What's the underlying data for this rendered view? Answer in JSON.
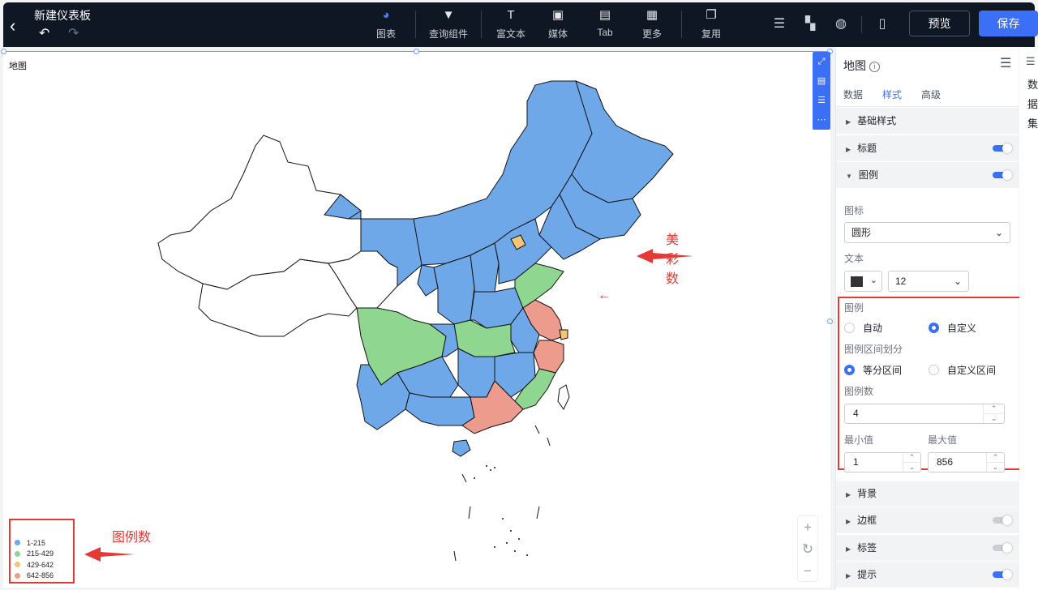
{
  "header": {
    "back_icon": "chevron-left-icon",
    "title": "新建仪表板",
    "tools": [
      {
        "label": "图表",
        "icon": "pie-chart-icon",
        "glyph": "◕",
        "active": true
      },
      {
        "label": "查询组件",
        "icon": "filter-icon",
        "glyph": "▼",
        "active": false
      },
      {
        "label": "富文本",
        "icon": "text-icon",
        "glyph": "T",
        "active": false
      },
      {
        "label": "媒体",
        "icon": "image-icon",
        "glyph": "▣",
        "active": false
      },
      {
        "label": "Tab",
        "icon": "tab-icon",
        "glyph": "▤",
        "active": false
      },
      {
        "label": "更多",
        "icon": "grid-icon",
        "glyph": "▦",
        "active": false
      },
      {
        "label": "复用",
        "icon": "copy-icon",
        "glyph": "❐",
        "active": false
      }
    ],
    "preview_label": "预览",
    "save_label": "保存",
    "accent": "#3b6ff5"
  },
  "canvas": {
    "title": "地图",
    "annotation_color": "美彩数",
    "annotation_legend": "图例数"
  },
  "legend": {
    "items": [
      {
        "label": "1-215",
        "color": "#6fa8e8"
      },
      {
        "label": "215-429",
        "color": "#8fd691"
      },
      {
        "label": "429-642",
        "color": "#f2c57a"
      },
      {
        "label": "642-856",
        "color": "#ec9b8c"
      }
    ]
  },
  "panel": {
    "title": "地图",
    "tabs": [
      {
        "label": "数据",
        "active": false
      },
      {
        "label": "样式",
        "active": true
      },
      {
        "label": "高级",
        "active": false
      }
    ],
    "sections": {
      "basic": "基础样式",
      "title": "标题",
      "legend": "图例",
      "background": "背景",
      "border": "边框",
      "label": "标签",
      "tooltip": "提示"
    },
    "icon_label": "图标",
    "icon_value": "圆形",
    "text_label": "文本",
    "font_size": "12",
    "legend_label": "图例",
    "legend_auto": "自动",
    "legend_custom": "自定义",
    "interval_label": "图例区间划分",
    "interval_equal": "等分区间",
    "interval_custom": "自定义区间",
    "count_label": "图例数",
    "count_value": "4",
    "min_label": "最小值",
    "min_value": "1",
    "max_label": "最大值",
    "max_value": "856"
  },
  "far_right": {
    "text": "数据集"
  }
}
